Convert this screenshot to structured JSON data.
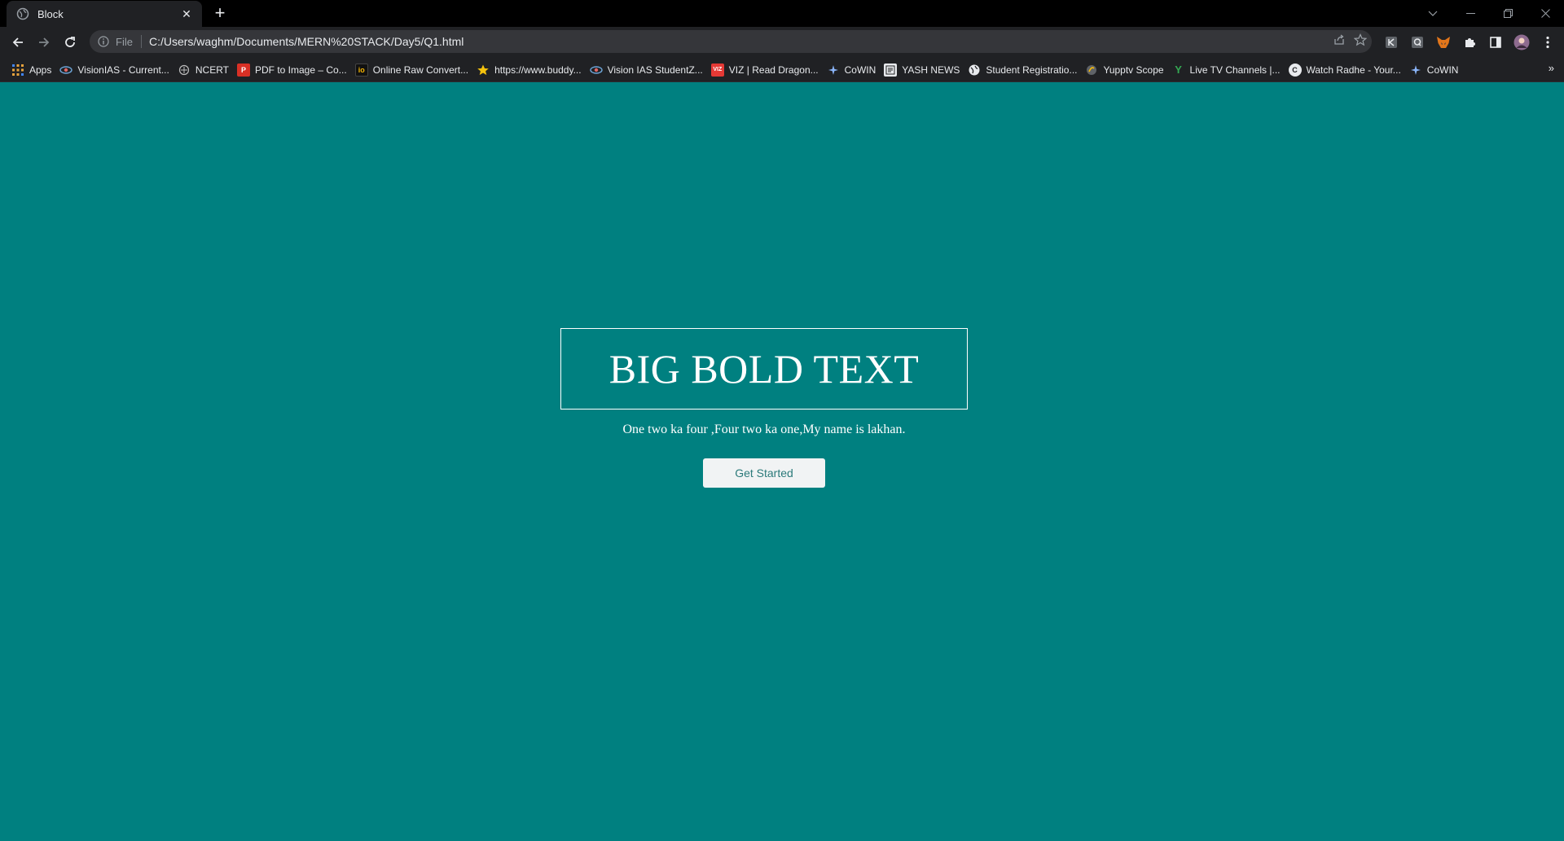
{
  "browser": {
    "tab": {
      "title": "Block"
    },
    "omnibox": {
      "scheme": "File",
      "url": "C:/Users/waghm/Documents/MERN%20STACK/Day5/Q1.html"
    },
    "bookmarks": [
      {
        "label": "Apps",
        "icon": "apps-grid-icon"
      },
      {
        "label": "VisionIAS - Current...",
        "icon": "vision-ias-icon"
      },
      {
        "label": "NCERT",
        "icon": "ncert-icon"
      },
      {
        "label": "PDF to Image – Co...",
        "icon": "pdf-icon"
      },
      {
        "label": "Online Raw Convert...",
        "icon": "io-icon"
      },
      {
        "label": "https://www.buddy...",
        "icon": "star-badge-icon"
      },
      {
        "label": "Vision IAS StudentZ...",
        "icon": "vision-ias-icon"
      },
      {
        "label": "VIZ | Read Dragon...",
        "icon": "viz-icon"
      },
      {
        "label": "CoWIN",
        "icon": "cowin-icon"
      },
      {
        "label": "YASH NEWS",
        "icon": "news-icon"
      },
      {
        "label": "Student Registratio...",
        "icon": "globe-icon"
      },
      {
        "label": "Yupptv Scope",
        "icon": "yupptv-icon"
      },
      {
        "label": "Live TV Channels |...",
        "icon": "y-icon"
      },
      {
        "label": "Watch Radhe - Your...",
        "icon": "c-icon"
      },
      {
        "label": "CoWIN",
        "icon": "cowin-icon"
      }
    ],
    "more_label": "»"
  },
  "page": {
    "heading": "BIG BOLD TEXT",
    "subtitle": "One two ka four ,Four two ka one,My name is lakhan.",
    "cta_label": "Get Started",
    "background_color": "#008080"
  }
}
